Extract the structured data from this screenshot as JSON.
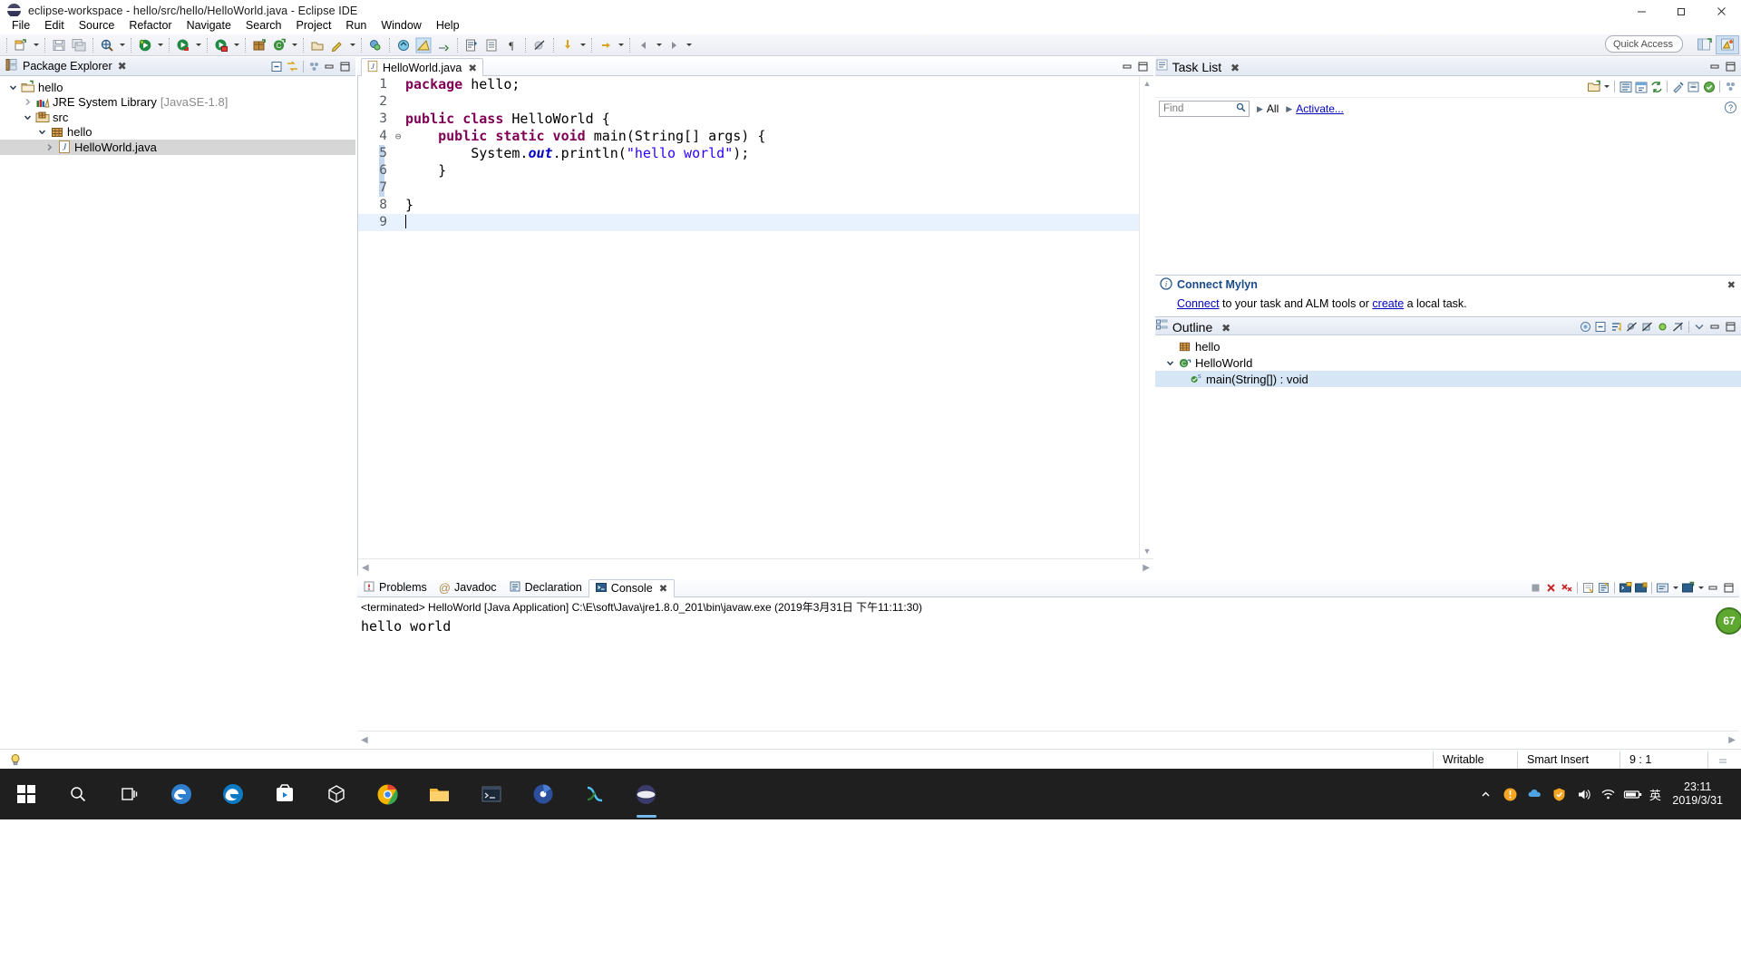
{
  "window": {
    "title": "eclipse-workspace - hello/src/hello/HelloWorld.java - Eclipse IDE",
    "app_icon": "eclipse-icon",
    "minimize": "minimize-icon",
    "maximize": "restore-icon",
    "close": "close-icon"
  },
  "menubar": {
    "items": [
      {
        "label": "File"
      },
      {
        "label": "Edit"
      },
      {
        "label": "Source"
      },
      {
        "label": "Refactor"
      },
      {
        "label": "Navigate"
      },
      {
        "label": "Search"
      },
      {
        "label": "Project"
      },
      {
        "label": "Run"
      },
      {
        "label": "Window"
      },
      {
        "label": "Help"
      }
    ]
  },
  "toolbar": {
    "quick_access_placeholder": "Quick Access",
    "buttons": [
      {
        "name": "new-wizard",
        "icon": "new-file-icon"
      },
      {
        "name": "save",
        "icon": "save-icon"
      },
      {
        "name": "save-all",
        "icon": "save-all-icon"
      },
      {
        "name": "build",
        "icon": "build-icon"
      },
      {
        "name": "debug",
        "icon": "debug-icon"
      },
      {
        "name": "run",
        "icon": "run-icon"
      },
      {
        "name": "coverage",
        "icon": "coverage-icon"
      },
      {
        "name": "new-java-package",
        "icon": "package-icon"
      },
      {
        "name": "new-java-class",
        "icon": "class-icon"
      },
      {
        "name": "open-type",
        "icon": "open-type-icon"
      },
      {
        "name": "external-tools",
        "icon": "external-tools-icon"
      },
      {
        "name": "search",
        "icon": "search-icon"
      },
      {
        "name": "previous-annotation",
        "icon": "prev-annotation-icon"
      },
      {
        "name": "next-annotation",
        "icon": "next-annotation-icon"
      },
      {
        "name": "last-edit-location",
        "icon": "last-edit-icon"
      },
      {
        "name": "back",
        "icon": "back-icon"
      },
      {
        "name": "forward",
        "icon": "forward-icon"
      }
    ],
    "perspective": {
      "open_perspective": "open-perspective-icon",
      "java_perspective": "java-perspective-icon"
    }
  },
  "package_explorer": {
    "title": "Package Explorer",
    "close": "close-icon",
    "tools": [
      {
        "name": "collapse-all",
        "icon": "collapse-all-icon"
      },
      {
        "name": "link-with-editor",
        "icon": "link-editor-icon"
      },
      {
        "name": "view-menu",
        "icon": "view-menu-icon"
      },
      {
        "name": "minimize",
        "icon": "minimize-icon"
      },
      {
        "name": "maximize",
        "icon": "maximize-icon"
      }
    ],
    "tree": [
      {
        "label": "hello",
        "icon": "java-project-icon",
        "indent": 0,
        "twisty": "expanded",
        "selected": false,
        "dim": ""
      },
      {
        "label": "JRE System Library",
        "icon": "library-icon",
        "indent": 1,
        "twisty": "collapsed",
        "selected": false,
        "dim": "[JavaSE-1.8]"
      },
      {
        "label": "src",
        "icon": "source-folder-icon",
        "indent": 1,
        "twisty": "expanded",
        "selected": false,
        "dim": ""
      },
      {
        "label": "hello",
        "icon": "package-icon",
        "indent": 2,
        "twisty": "expanded",
        "selected": false,
        "dim": ""
      },
      {
        "label": "HelloWorld.java",
        "icon": "java-file-icon",
        "indent": 3,
        "twisty": "collapsed",
        "selected": true,
        "dim": ""
      }
    ]
  },
  "editor": {
    "tab": {
      "label": "HelloWorld.java",
      "icon": "java-file-icon",
      "close": "close-icon"
    },
    "tools": [
      {
        "name": "minimize",
        "icon": "minimize-icon"
      },
      {
        "name": "maximize",
        "icon": "maximize-icon"
      }
    ],
    "lines": [
      {
        "num": "1",
        "fold": "",
        "tokens": [
          {
            "t": "package",
            "c": "kw"
          },
          {
            "t": " hello;",
            "c": "pl"
          }
        ],
        "current": false
      },
      {
        "num": "2",
        "fold": "",
        "tokens": [],
        "current": false
      },
      {
        "num": "3",
        "fold": "",
        "tokens": [
          {
            "t": "public class ",
            "c": "kw"
          },
          {
            "t": "HelloWorld {",
            "c": "pl"
          }
        ],
        "current": false
      },
      {
        "num": "4",
        "fold": "collapse",
        "tokens": [
          {
            "t": "    ",
            "c": "pl"
          },
          {
            "t": "public static void ",
            "c": "kw"
          },
          {
            "t": "main(String[] args) {",
            "c": "pl"
          }
        ],
        "current": false
      },
      {
        "num": "5",
        "fold": "",
        "tokens": [
          {
            "t": "        System.",
            "c": "pl"
          },
          {
            "t": "out",
            "c": "fld"
          },
          {
            "t": ".println(",
            "c": "pl"
          },
          {
            "t": "\"hello world\"",
            "c": "str"
          },
          {
            "t": ");",
            "c": "pl"
          }
        ],
        "current": false
      },
      {
        "num": "6",
        "fold": "",
        "tokens": [
          {
            "t": "    }",
            "c": "pl"
          }
        ],
        "current": false
      },
      {
        "num": "7",
        "fold": "",
        "tokens": [],
        "current": false
      },
      {
        "num": "8",
        "fold": "",
        "tokens": [
          {
            "t": "}",
            "c": "pl"
          }
        ],
        "current": false
      },
      {
        "num": "9",
        "fold": "",
        "tokens": [],
        "current": true
      }
    ]
  },
  "bottom_panel": {
    "tabs": [
      {
        "label": "Problems",
        "icon": "problems-icon",
        "active": false
      },
      {
        "label": "Javadoc",
        "icon": "javadoc-icon",
        "active": false
      },
      {
        "label": "Declaration",
        "icon": "declaration-icon",
        "active": false
      },
      {
        "label": "Console",
        "icon": "console-icon",
        "active": true,
        "close": "close-icon"
      }
    ],
    "tools": [
      {
        "name": "terminate",
        "icon": "terminate-icon"
      },
      {
        "name": "remove-launch",
        "icon": "remove-icon"
      },
      {
        "name": "remove-all-terminated",
        "icon": "remove-all-icon"
      },
      {
        "name": "clear-console",
        "icon": "clear-console-icon"
      },
      {
        "name": "scroll-lock",
        "icon": "scroll-lock-icon"
      },
      {
        "name": "show-console-on-output",
        "icon": "show-console-icon"
      },
      {
        "name": "pin-console",
        "icon": "pin-icon"
      },
      {
        "name": "display-selected-console",
        "icon": "display-console-icon"
      },
      {
        "name": "open-console",
        "icon": "open-console-icon"
      },
      {
        "name": "minimize",
        "icon": "minimize-icon"
      },
      {
        "name": "maximize",
        "icon": "maximize-icon"
      }
    ],
    "launch_status": "<terminated> HelloWorld [Java Application] C:\\E\\soft\\Java\\jre1.8.0_201\\bin\\javaw.exe (2019年3月31日 下午11:11:30)",
    "output": "hello world"
  },
  "task_list": {
    "title": "Task List",
    "close": "close-icon",
    "tools": [
      {
        "name": "new-task",
        "icon": "new-task-icon"
      },
      {
        "name": "new-task-menu",
        "icon": "chevron-down-icon"
      },
      {
        "name": "categorized-presentation",
        "icon": "categorized-icon"
      },
      {
        "name": "scheduled-presentation",
        "icon": "scheduled-icon"
      },
      {
        "name": "synchronize-changed",
        "icon": "synchronize-icon"
      },
      {
        "name": "focus-on-workweek",
        "icon": "focus-icon"
      },
      {
        "name": "collapse-all",
        "icon": "collapse-all-icon"
      },
      {
        "name": "restore-tasks",
        "icon": "restore-icon"
      },
      {
        "name": "view-menu",
        "icon": "view-menu-icon"
      },
      {
        "name": "minimize",
        "icon": "minimize-icon"
      },
      {
        "name": "maximize",
        "icon": "maximize-icon"
      }
    ],
    "find_placeholder": "Find",
    "find_icon": "search-icon",
    "all_label": "All",
    "activate_label": "Activate...",
    "help_icon": "help-icon"
  },
  "connect_mylyn": {
    "icon": "info-icon",
    "title": "Connect Mylyn",
    "close": "close-icon",
    "text_before": "",
    "link1": "Connect",
    "text_middle": " to your task and ALM tools or ",
    "link2": "create",
    "text_after": " a local task."
  },
  "outline": {
    "title": "Outline",
    "close": "close-icon",
    "tools": [
      {
        "name": "focus-on-active-task",
        "icon": "focus-task-icon"
      },
      {
        "name": "collapse-all",
        "icon": "collapse-all-icon"
      },
      {
        "name": "sort",
        "icon": "sort-icon"
      },
      {
        "name": "hide-fields",
        "icon": "hide-fields-icon"
      },
      {
        "name": "hide-static-fields",
        "icon": "hide-static-icon"
      },
      {
        "name": "hide-non-public",
        "icon": "hide-nonpublic-icon"
      },
      {
        "name": "hide-local-types",
        "icon": "hide-local-icon"
      },
      {
        "name": "view-menu",
        "icon": "view-menu-icon"
      },
      {
        "name": "minimize",
        "icon": "minimize-icon"
      },
      {
        "name": "maximize",
        "icon": "maximize-icon"
      }
    ],
    "tree": [
      {
        "label": "hello",
        "icon": "package-icon",
        "indent": 1,
        "twisty": "",
        "badge": ""
      },
      {
        "label": "HelloWorld",
        "icon": "class-icon",
        "indent": 1,
        "twisty": "expanded",
        "badge": ""
      },
      {
        "label": "main(String[]) : void",
        "icon": "method-public-static-icon",
        "indent": 2,
        "twisty": "",
        "badge": "S"
      }
    ]
  },
  "status_bar": {
    "left_icon": "tip-icon",
    "writable": "Writable",
    "insert_mode": "Smart Insert",
    "cursor_position": "9 : 1"
  },
  "mylyn_badge": "67",
  "taskbar": {
    "items": [
      {
        "name": "start-button",
        "icon": "windows-icon"
      },
      {
        "name": "search",
        "icon": "search-icon"
      },
      {
        "name": "task-view",
        "icon": "task-view-icon"
      },
      {
        "name": "edge-legacy",
        "icon": "edge-legacy-icon"
      },
      {
        "name": "edge",
        "icon": "edge-icon"
      },
      {
        "name": "store",
        "icon": "store-icon"
      },
      {
        "name": "box",
        "icon": "box-icon"
      },
      {
        "name": "chrome",
        "icon": "chrome-icon"
      },
      {
        "name": "file-explorer",
        "icon": "folder-icon"
      },
      {
        "name": "terminal",
        "icon": "terminal-icon"
      },
      {
        "name": "media",
        "icon": "media-icon"
      },
      {
        "name": "vm",
        "icon": "vm-icon"
      },
      {
        "name": "eclipse",
        "icon": "eclipse-icon",
        "active": true
      }
    ],
    "tray": {
      "chevron": "show-hidden-icons",
      "icons": [
        "shield-icon",
        "cloud-icon",
        "antivirus-icon",
        "volume-icon",
        "network-icon",
        "battery-icon"
      ],
      "ime": "英",
      "time": "23:11",
      "date": "2019/3/31"
    }
  },
  "colors": {
    "keyword": "#7f0055",
    "string": "#2a00ff",
    "field": "#0000c0",
    "plain": "#000000",
    "selection": "#d6d6d6",
    "current_line": "#e8f2fe",
    "accent": "#1b4a8a"
  }
}
